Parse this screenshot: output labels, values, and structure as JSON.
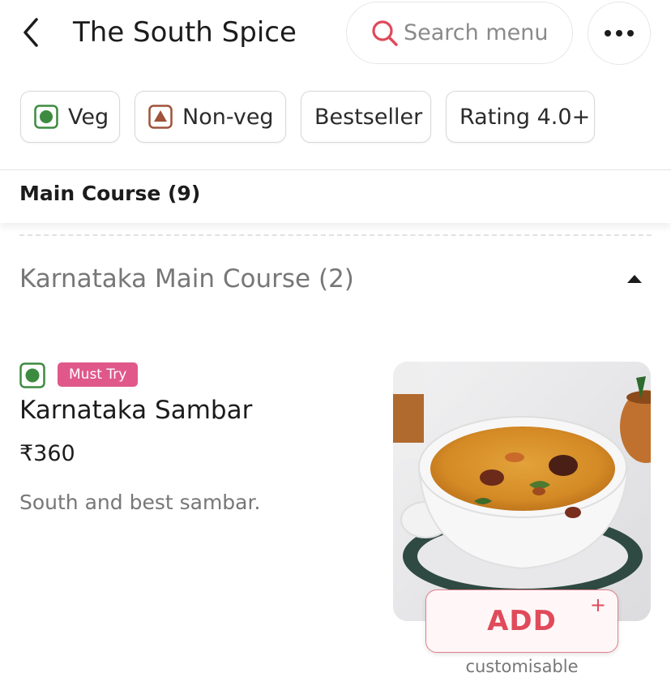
{
  "header": {
    "title": "The South Spice",
    "search_placeholder": "Search menu"
  },
  "filters": [
    {
      "label": "Veg",
      "icon": "veg-indicator-icon"
    },
    {
      "label": "Non-veg",
      "icon": "non-veg-indicator-icon"
    },
    {
      "label": "Bestseller"
    },
    {
      "label": "Rating 4.0+"
    }
  ],
  "section": {
    "label": "Main Course (9)"
  },
  "subcategory": {
    "label": "Karnataka Main Course (2)",
    "expanded": true
  },
  "item": {
    "badge": "Must Try",
    "name": "Karnataka Sambar",
    "price": "₹360",
    "description": "South and best sambar.",
    "add_label": "ADD",
    "add_plus": "+",
    "customisable": "customisable"
  },
  "colors": {
    "accent": "#e04a5a",
    "veg_green": "#3d8b40",
    "nonveg_brown": "#a0523a",
    "badge_pink": "#e0588a"
  }
}
